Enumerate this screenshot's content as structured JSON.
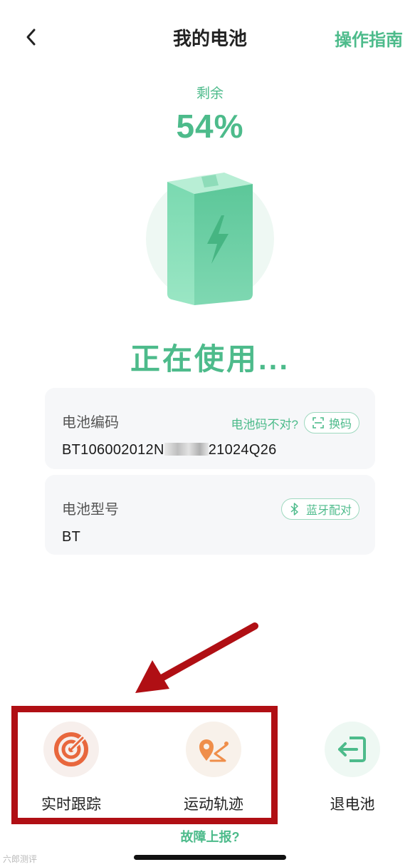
{
  "header": {
    "title": "我的电池",
    "guide_label": "操作指南"
  },
  "battery": {
    "remain_label": "剩余",
    "percent": "54%",
    "level": 0.54,
    "status": "正在使用..."
  },
  "code_card": {
    "label": "电池编码",
    "wrong_code_link": "电池码不对?",
    "change_button": "换码",
    "value_prefix": "BT106002012N",
    "value_suffix": "21024Q26"
  },
  "model_card": {
    "label": "电池型号",
    "bluetooth_button": "蓝牙配对",
    "value": "BT"
  },
  "actions": {
    "tracking": "实时跟踪",
    "trajectory": "运动轨迹",
    "return_battery": "退电池"
  },
  "fault_link": "故障上报?",
  "watermark": "六郎测评",
  "colors": {
    "accent": "#4dbb8b",
    "annotation_red": "#b00f14",
    "orange_icon": "#e8673d"
  }
}
